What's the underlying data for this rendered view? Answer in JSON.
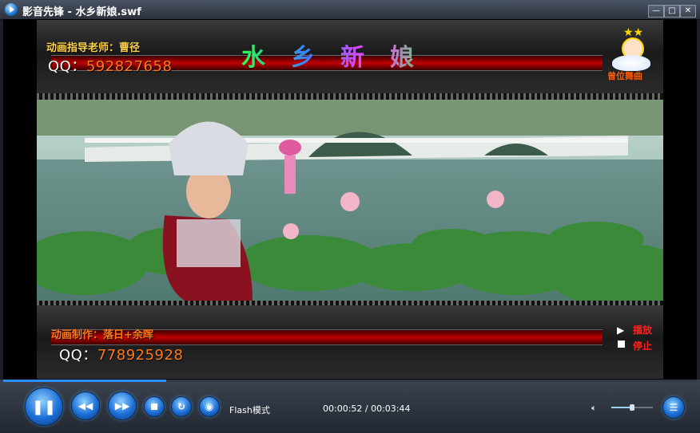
{
  "window": {
    "title": "影音先锋 - 水乡新娘.swf",
    "min": "—",
    "max": "□",
    "close": "✕"
  },
  "flash": {
    "top_credit": "动画指导老师：曹径",
    "top_qq_label": "QQ：",
    "top_qq_number": "592827658",
    "song_title": "水乡新娘",
    "corner_badge": "曾位舞曲",
    "bottom_credit": "动画制作：落日+余晖",
    "bottom_qq_label": "QQ：",
    "bottom_qq_number": "778925928",
    "play_label": "播放",
    "stop_label": "停止"
  },
  "player": {
    "progress": 0.235,
    "mode": "Flash模式",
    "time": "00:00:52 / 00:03:44",
    "volume": 0.5
  },
  "icons": {
    "pause": "pause-icon",
    "prev": "rewind-icon",
    "next": "forward-icon",
    "stop": "stop-icon",
    "loop": "loop-icon",
    "disc": "disc-icon",
    "playlist": "playlist-icon",
    "volume": "speaker-icon"
  }
}
